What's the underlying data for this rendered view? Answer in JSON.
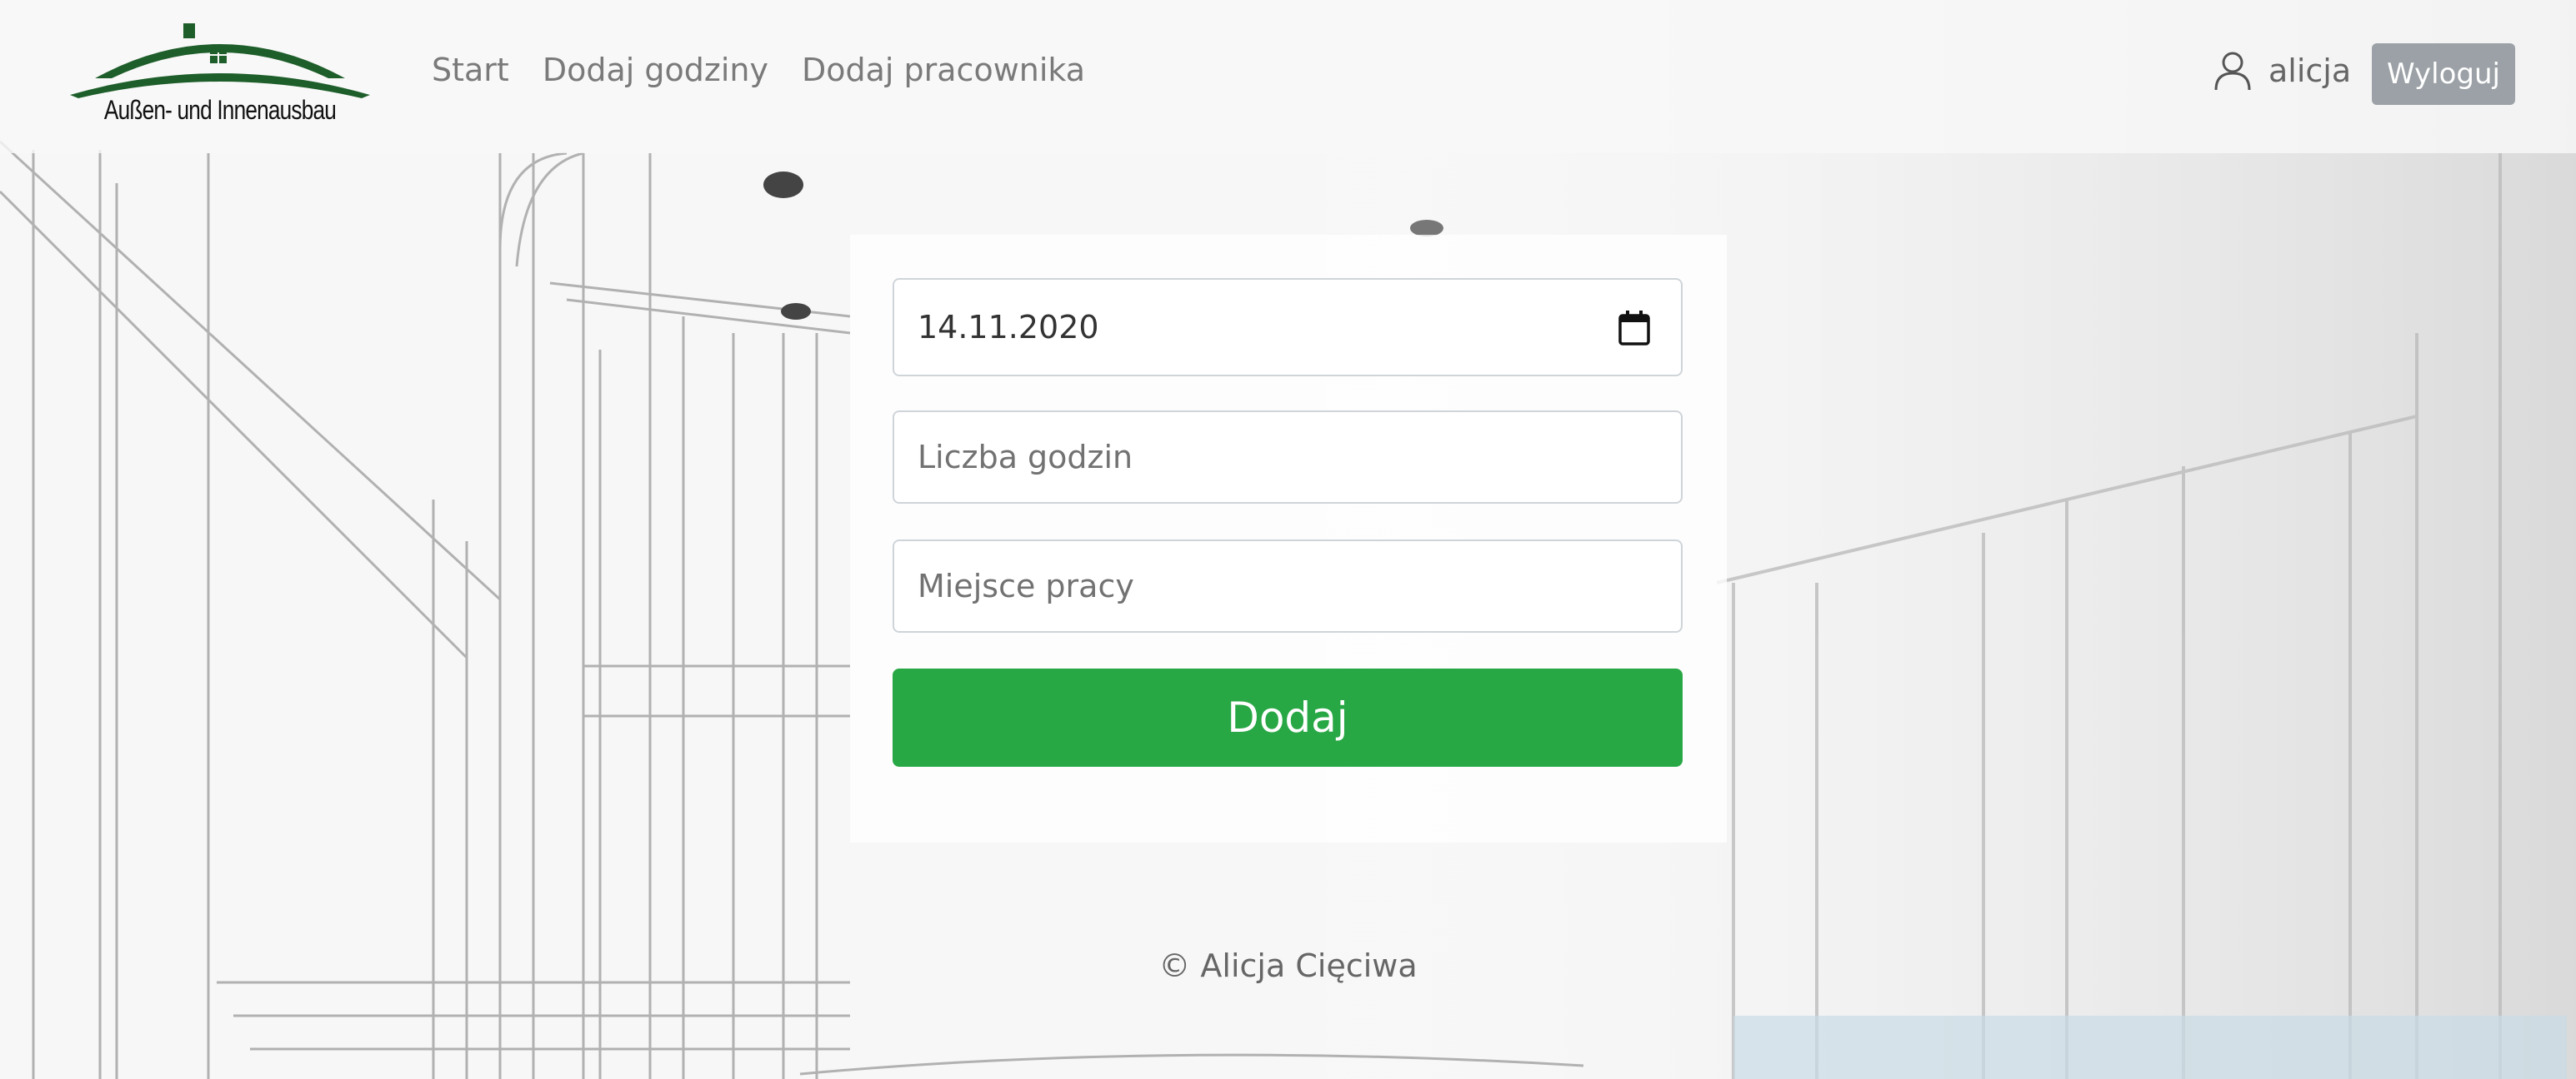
{
  "brand": {
    "logo_text": "Außen- und Innenausbau"
  },
  "nav": {
    "items": [
      {
        "label": "Start"
      },
      {
        "label": "Dodaj godziny"
      },
      {
        "label": "Dodaj pracownika"
      }
    ]
  },
  "user": {
    "name": "alicja",
    "icon": "user-icon",
    "logout_label": "Wyloguj"
  },
  "form": {
    "date_value": "14.11.2020",
    "date_icon": "calendar-icon",
    "hours_placeholder": "Liczba godzin",
    "place_placeholder": "Miejsce pracy",
    "submit_label": "Dodaj"
  },
  "footer": {
    "copyright": "© Alicja Cięciwa"
  },
  "colors": {
    "brand_green": "#1e5e2a",
    "submit_green": "#28a745",
    "logout_gray": "#9ba1a6"
  }
}
